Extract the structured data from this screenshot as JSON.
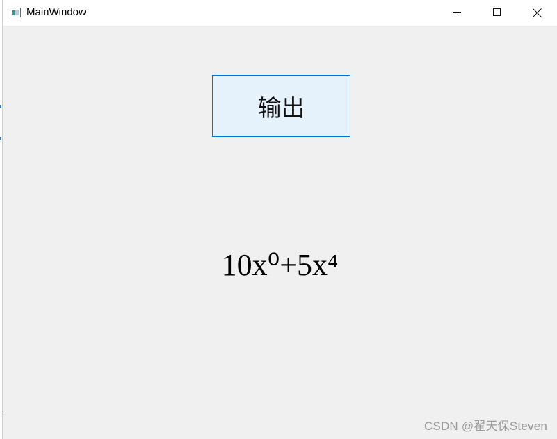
{
  "window": {
    "title": "MainWindow",
    "controls": {
      "minimize_icon": "minimize-icon",
      "maximize_icon": "maximize-icon",
      "close_icon": "close-icon"
    }
  },
  "main": {
    "output_button_label": "输出",
    "result_text": "10x⁰+5x⁴"
  },
  "watermark": "CSDN @翟天保Steven",
  "colors": {
    "client_background": "#f0f0f0",
    "titlebar_background": "#ffffff",
    "button_background": "#e5f1fb",
    "button_border": "#0078d7",
    "watermark": "#9a9a9a"
  }
}
